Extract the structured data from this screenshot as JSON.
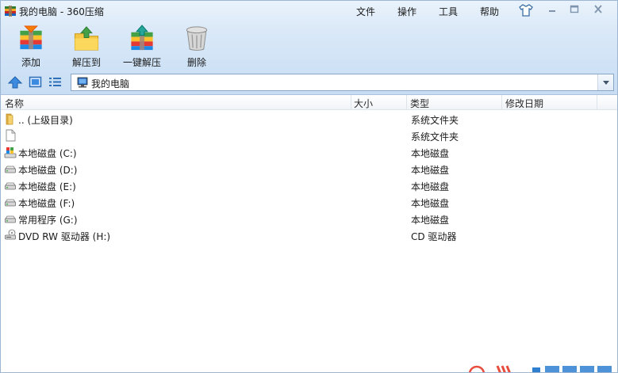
{
  "window": {
    "title": "我的电脑 - 360压缩"
  },
  "menu": {
    "file": "文件",
    "operate": "操作",
    "tools": "工具",
    "help": "帮助"
  },
  "toolbar": {
    "add_label": "添加",
    "extract_label": "解压到",
    "oneclick_label": "一键解压",
    "delete_label": "删除"
  },
  "address": {
    "value": "我的电脑"
  },
  "columns": {
    "name": "名称",
    "size": "大小",
    "type": "类型",
    "modified": "修改日期"
  },
  "rows": [
    {
      "name": ".. (上级目录)",
      "type": "系统文件夹",
      "icon": "folder-icon"
    },
    {
      "name": "",
      "type": "系统文件夹",
      "icon": "blank-file-icon"
    },
    {
      "name": "本地磁盘 (C:)",
      "type": "本地磁盘",
      "icon": "system-drive-icon"
    },
    {
      "name": "本地磁盘 (D:)",
      "type": "本地磁盘",
      "icon": "hard-drive-icon"
    },
    {
      "name": "本地磁盘 (E:)",
      "type": "本地磁盘",
      "icon": "hard-drive-icon"
    },
    {
      "name": "本地磁盘 (F:)",
      "type": "本地磁盘",
      "icon": "hard-drive-icon"
    },
    {
      "name": "常用程序 (G:)",
      "type": "本地磁盘",
      "icon": "hard-drive-icon"
    },
    {
      "name": "DVD RW 驱动器 (H:)",
      "type": "CD 驱动器",
      "icon": "dvd-drive-icon"
    }
  ]
}
